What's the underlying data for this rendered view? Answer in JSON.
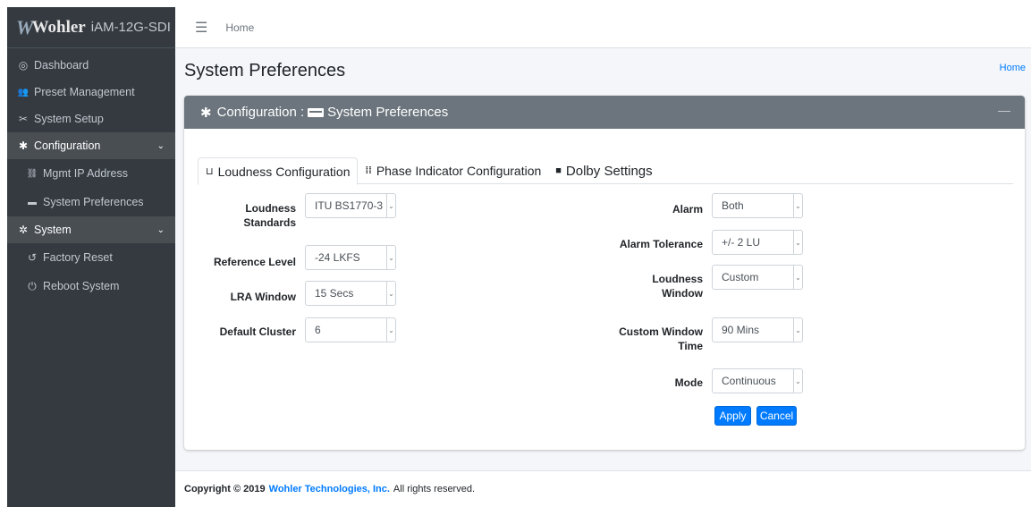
{
  "brand": {
    "logo": "Wohler",
    "model": "iAM-12G-SDI"
  },
  "sidebar": {
    "items": [
      {
        "label": "Dashboard",
        "icon": "dashboard-icon",
        "glyph": "◎"
      },
      {
        "label": "Preset Management",
        "icon": "users-icon",
        "glyph": "👥"
      },
      {
        "label": "System Setup",
        "icon": "tools-icon",
        "glyph": "✂"
      },
      {
        "label": "Configuration",
        "icon": "gear-icon",
        "glyph": "✱"
      },
      {
        "label": "Mgmt IP Address",
        "icon": "network-icon",
        "glyph": "⛓"
      },
      {
        "label": "System Preferences",
        "icon": "keyboard-icon",
        "glyph": "▬"
      },
      {
        "label": "System",
        "icon": "cogs-icon",
        "glyph": "✲"
      },
      {
        "label": "Factory Reset",
        "icon": "undo-icon",
        "glyph": "↺"
      },
      {
        "label": "Reboot System",
        "icon": "power-icon",
        "glyph": "⏻"
      }
    ]
  },
  "topbar": {
    "home": "Home"
  },
  "page": {
    "title": "System Preferences",
    "breadcrumb": "Home"
  },
  "card": {
    "header_prefix": "Configuration :",
    "header_suffix": "System Preferences",
    "minus": "—"
  },
  "tabs": [
    {
      "label": "Loudness Configuration",
      "glyph": "⊔"
    },
    {
      "label": "Phase Indicator Configuration",
      "glyph": "⁞⁞"
    },
    {
      "label": "Dolby Settings",
      "glyph": "■"
    }
  ],
  "form": {
    "loudness_standards": {
      "label": "Loudness Standards",
      "value": "ITU BS1770-3"
    },
    "reference_level": {
      "label": "Reference Level",
      "value": "-24 LKFS"
    },
    "lra_window": {
      "label": "LRA Window",
      "value": "15 Secs"
    },
    "default_cluster": {
      "label": "Default Cluster",
      "value": "6"
    },
    "alarm": {
      "label": "Alarm",
      "value": "Both"
    },
    "alarm_tolerance": {
      "label": "Alarm Tolerance",
      "value": "+/- 2 LU"
    },
    "loudness_window": {
      "label": "Loudness Window",
      "value": "Custom"
    },
    "custom_window_time": {
      "label": "Custom Window Time",
      "value": "90 Mins"
    },
    "mode": {
      "label": "Mode",
      "value": "Continuous"
    }
  },
  "buttons": {
    "apply": "Apply",
    "cancel": "Cancel"
  },
  "footer": {
    "prefix": "Copyright © 2019",
    "company": "Wohler Technologies, Inc.",
    "suffix": "All rights reserved."
  },
  "colors": {
    "sidebar": "#343a40",
    "card_header": "#6c757d",
    "primary": "#007bff"
  }
}
